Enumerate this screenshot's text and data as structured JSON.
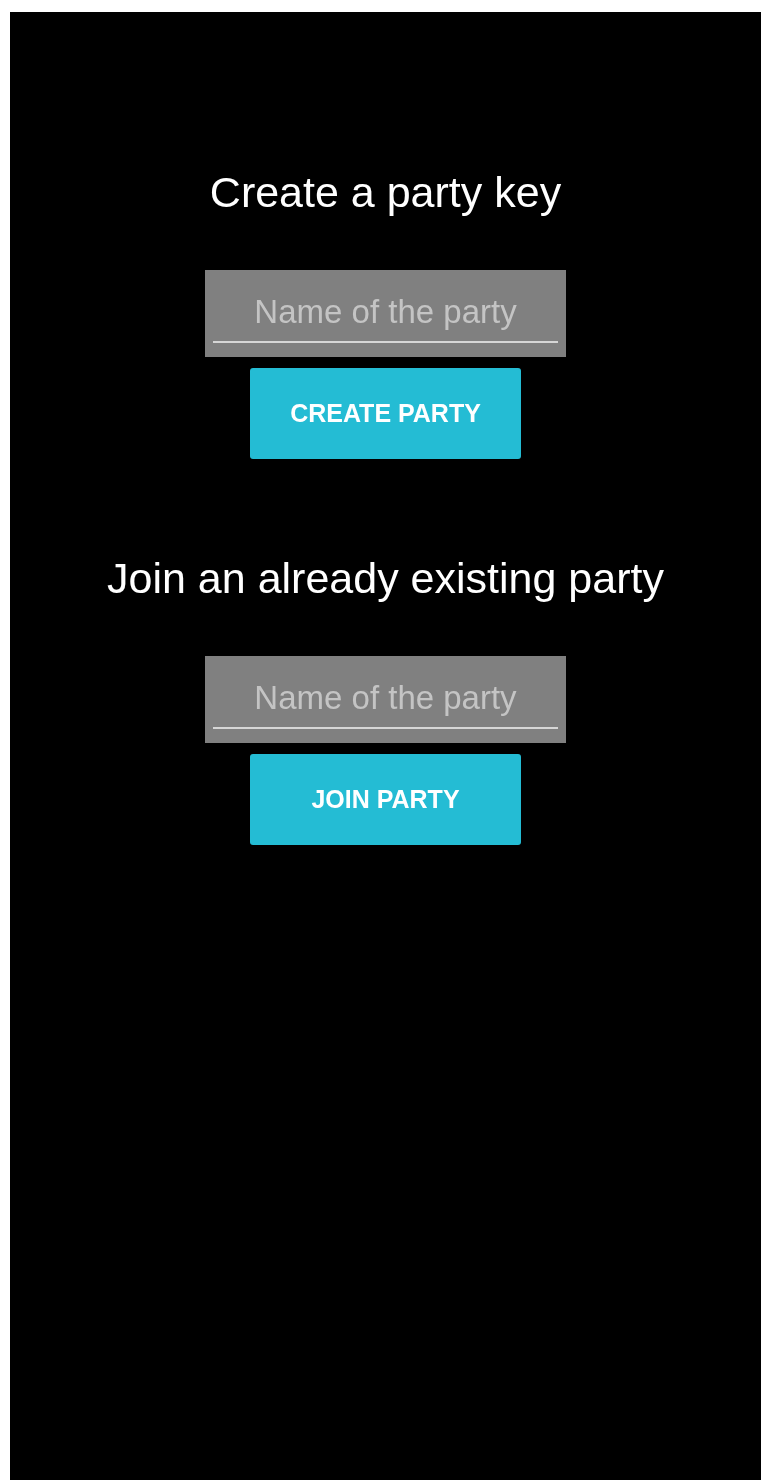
{
  "sections": [
    {
      "title": "Create a party key",
      "field": {
        "placeholder": "Name of the party"
      },
      "button": "CREATE PARTY"
    },
    {
      "title": "Join an already existing party",
      "field": {
        "placeholder": "Name of the party"
      },
      "button": "JOIN PARTY"
    }
  ]
}
